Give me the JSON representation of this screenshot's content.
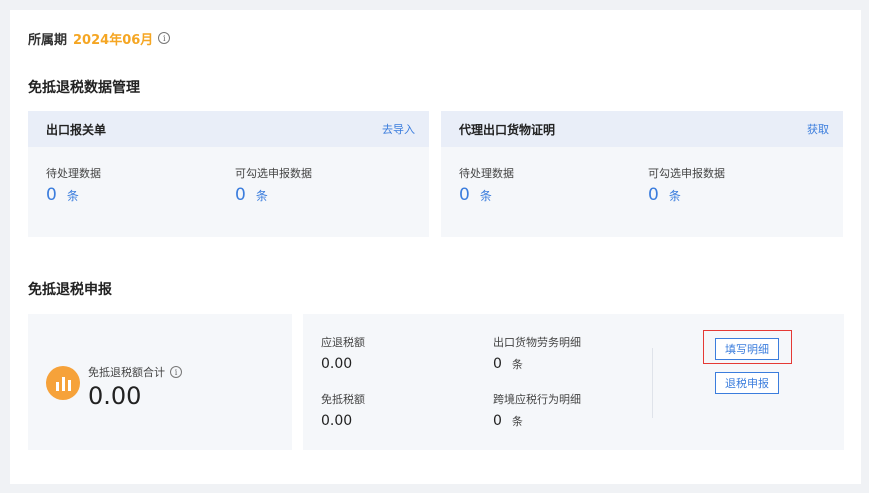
{
  "period": {
    "label": "所属期",
    "value": "2024年06月",
    "icon": "info-icon"
  },
  "data_mgmt": {
    "title": "免抵退税数据管理",
    "cards": [
      {
        "title": "出口报关单",
        "action": "去导入",
        "stats": [
          {
            "label": "待处理数据",
            "value": "0",
            "unit": "条"
          },
          {
            "label": "可勾选申报数据",
            "value": "0",
            "unit": "条"
          }
        ]
      },
      {
        "title": "代理出口货物证明",
        "action": "获取",
        "stats": [
          {
            "label": "待处理数据",
            "value": "0",
            "unit": "条"
          },
          {
            "label": "可勾选申报数据",
            "value": "0",
            "unit": "条"
          }
        ]
      }
    ]
  },
  "declaration": {
    "title": "免抵退税申报",
    "total": {
      "label": "免抵退税额合计",
      "value": "0.00",
      "icon": "bar-chart-icon"
    },
    "items": {
      "refund": {
        "label": "应退税额",
        "value": "0.00"
      },
      "exempt": {
        "label": "免抵税额",
        "value": "0.00"
      },
      "export_detail": {
        "label": "出口货物劳务明细",
        "value": "0",
        "unit": "条"
      },
      "cross_border": {
        "label": "跨境应税行为明细",
        "value": "0",
        "unit": "条"
      }
    },
    "buttons": {
      "fill_detail": "填写明细",
      "refund_declare": "退税申报"
    }
  },
  "colors": {
    "accent": "#3b7ddd",
    "period": "#f5a623",
    "highlight": "#e53935",
    "icon_bg": "#f6a23a"
  }
}
